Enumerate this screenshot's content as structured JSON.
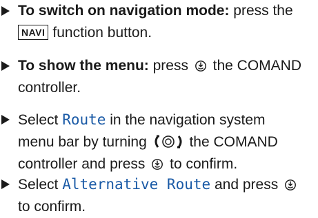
{
  "steps": [
    {
      "bold": "To switch on navigation mode:",
      "text1": " press the",
      "key": "NAVI",
      "text2": "function button."
    },
    {
      "bold": "To show the menu:",
      "text1": " press",
      "text2": "the COMAND",
      "text3": "controller."
    },
    {
      "text1": "Select ",
      "term": "Route",
      "text2": " in the navigation system",
      "text3": "menu bar by turning",
      "text4": "the COMAND",
      "text5": "controller and press",
      "text6": "to confirm."
    },
    {
      "text1": "Select ",
      "term": "Alternative Route",
      "text2": " and press",
      "text3": "to confirm."
    }
  ],
  "icons": [
    "bullet-arrow-icon",
    "navi-key",
    "controller-press-icon",
    "controller-rotate-icon"
  ]
}
